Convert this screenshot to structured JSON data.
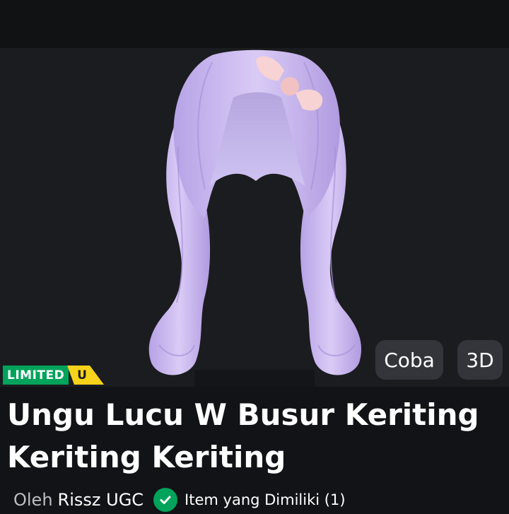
{
  "item": {
    "title": "Ungu Lucu W Busur Keriting Keriting Keriting",
    "limited_label": "LIMITED",
    "limited_badge": "U",
    "by_prefix": "Oleh",
    "creator": "Rissz UGC",
    "owned_text": "Item yang Dimiliki (1)"
  },
  "preview": {
    "try_on_label": "Coba",
    "view_3d_label": "3D"
  },
  "colors": {
    "hair": "#cdbbf0",
    "bow": "#f8d3d3",
    "limited_green": "#00a35b",
    "limited_yellow": "#f7d21b",
    "button_bg": "#33353b"
  },
  "icons": {
    "verified": "check-circle-icon"
  }
}
